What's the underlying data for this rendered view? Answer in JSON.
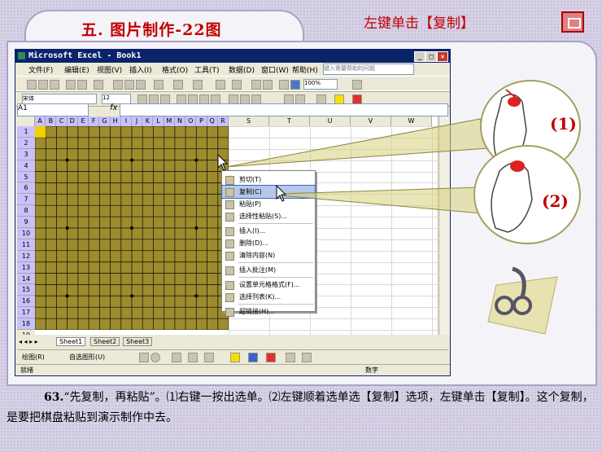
{
  "slide": {
    "title": "五. 图片制作-22图",
    "instruction": "左键单击【复制】",
    "label_1": "(1)",
    "label_2": "(2)",
    "caption_num": "63.",
    "caption_text": "“先复制，再粘贴”。⑴右键一按出选单。⑵左键顺着选单选【复制】选项，左键单击【复制】。这个复制，是要把棋盘粘贴到演示制作中去。"
  },
  "excel": {
    "window_title": "Microsoft Excel - Book1",
    "menu": [
      "文件(F)",
      "编辑(E)",
      "视图(V)",
      "插入(I)",
      "格式(O)",
      "工具(T)",
      "数据(D)",
      "窗口(W)",
      "帮助(H)"
    ],
    "help_placeholder": "键入需要帮助的问题",
    "zoom": "100%",
    "font_name": "宋体",
    "font_size": "12",
    "name_box": "A1",
    "fx": "fx",
    "columns_board": [
      "A",
      "B",
      "C",
      "D",
      "E",
      "F",
      "G",
      "H",
      "I",
      "J",
      "K",
      "L",
      "M",
      "N",
      "O",
      "P",
      "Q",
      "R"
    ],
    "columns_extra": [
      "S",
      "T",
      "U",
      "V",
      "W"
    ],
    "rows": [
      "1",
      "2",
      "3",
      "4",
      "5",
      "6",
      "7",
      "8",
      "9",
      "10",
      "11",
      "12",
      "13",
      "14",
      "15",
      "16",
      "17",
      "18",
      "19"
    ],
    "sheet_tabs": [
      "Sheet1",
      "Sheet2",
      "Sheet3"
    ],
    "draw_label": "绘图(R)",
    "autoshape_label": "自选图形(U)",
    "status_left": "就绪",
    "status_right": "数字"
  },
  "context_menu": {
    "items": [
      "剪切(T)",
      "复制(C)",
      "粘贴(P)",
      "选择性粘贴(S)...",
      "插入(I)...",
      "删除(D)...",
      "清除内容(N)",
      "插入批注(M)",
      "设置单元格格式(F)...",
      "选择列表(K)...",
      "超链接(H)..."
    ],
    "selected": "复制(C)"
  },
  "colors": {
    "board": "#9c8c2e",
    "accent_red": "#c00000",
    "titlebar": "#0a246a"
  }
}
